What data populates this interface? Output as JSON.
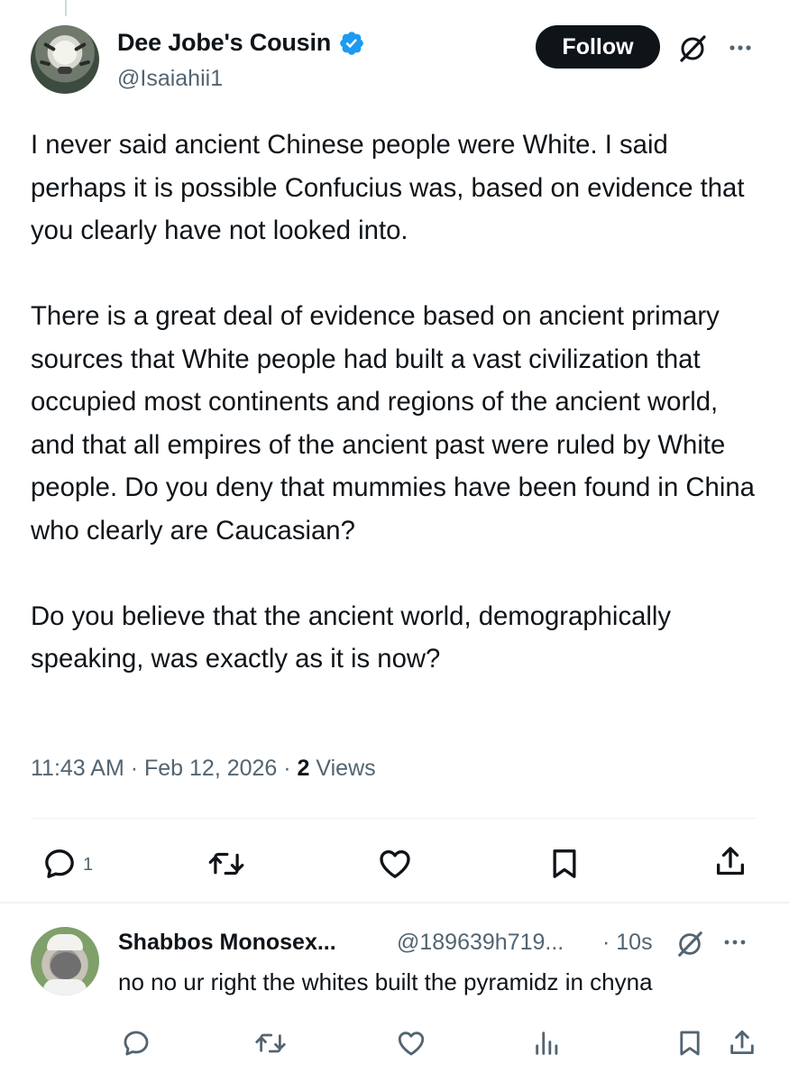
{
  "tweet": {
    "author_name": "Dee Jobe's Cousin",
    "author_handle": "@Isaiahii1",
    "follow_label": "Follow",
    "paragraphs": [
      "I never said ancient Chinese people were White. I said perhaps it is possible Confucius was, based on evidence that you clearly have not looked into.",
      "There is a great deal of evidence based on ancient primary sources that White people had built a vast civilization that occupied most continents and regions of the ancient world, and that all empires of the ancient past were ruled by White people. Do you deny that mummies have been found in China who clearly are Caucasian?",
      "Do you believe that the ancient world, demographically speaking, was exactly as it is now?"
    ],
    "timestamp": "11:43 AM · Feb 12, 2026 · ",
    "views_count": "2",
    "views_label": " Views",
    "reply_count": "1"
  },
  "reply": {
    "author_name": "Shabbos Monosex...",
    "author_handle": "@189639h719...",
    "time": "· 10s",
    "text": "no no ur right the whites built the pyramidz in chyna"
  },
  "colors": {
    "text": "#0f1419",
    "secondary": "#536471",
    "verified": "#1d9bf0",
    "divider": "#eff3f4"
  },
  "icons": [
    "verified-badge-icon",
    "grok-icon",
    "more-icon",
    "reply-icon",
    "retweet-icon",
    "like-icon",
    "bookmark-icon",
    "share-icon",
    "views-icon"
  ]
}
